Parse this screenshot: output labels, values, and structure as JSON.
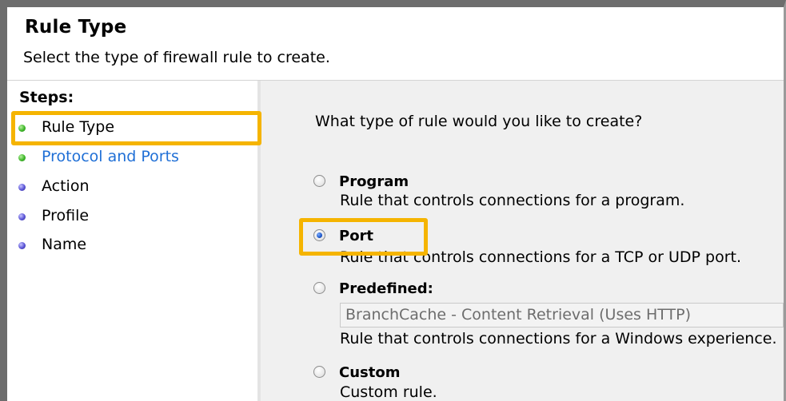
{
  "header": {
    "title": "Rule Type",
    "subtitle": "Select the type of firewall rule to create."
  },
  "steps": {
    "title": "Steps:",
    "items": [
      {
        "label": "Rule Type",
        "status": "current",
        "dot_color": "#3fb82a"
      },
      {
        "label": "Protocol and Ports",
        "status": "link",
        "dot_color": "#3fb82a"
      },
      {
        "label": "Action",
        "status": "pending",
        "dot_color": "#5a54d6"
      },
      {
        "label": "Profile",
        "status": "pending",
        "dot_color": "#5a54d6"
      },
      {
        "label": "Name",
        "status": "pending",
        "dot_color": "#5a54d6"
      }
    ]
  },
  "main": {
    "question": "What type of rule would you like to create?",
    "options": [
      {
        "label": "Program",
        "description": "Rule that controls connections for a program.",
        "selected": false
      },
      {
        "label": "Port",
        "description": "Rule that controls connections for a TCP or UDP port.",
        "selected": true
      },
      {
        "label": "Predefined:",
        "description": "Rule that controls connections for a Windows experience.",
        "selected": false
      },
      {
        "label": "Custom",
        "description": "Custom rule.",
        "selected": false
      }
    ],
    "predefined_value": "BranchCache - Content Retrieval (Uses HTTP)"
  },
  "colors": {
    "highlight": "#f5b400",
    "link": "#1f6fd6",
    "content_background": "#f0f0f0"
  }
}
